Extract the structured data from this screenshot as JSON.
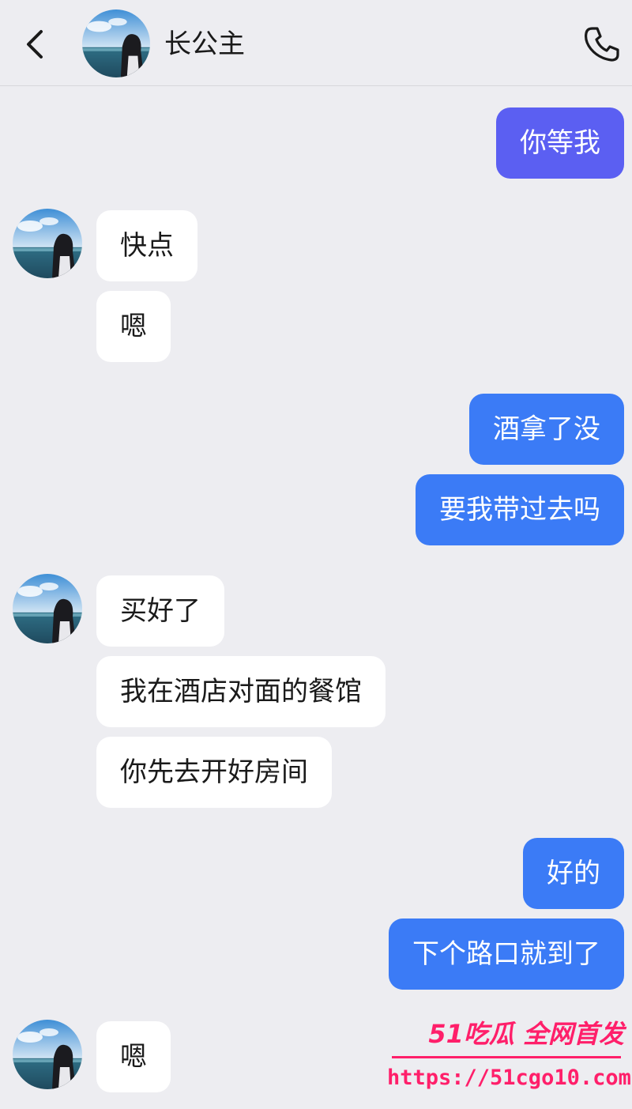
{
  "header": {
    "title": "长公主",
    "back_icon": "chevron-left-icon",
    "call_icon": "phone-icon"
  },
  "messages": [
    {
      "side": "out",
      "text": "你等我",
      "color": "#5b5ff2"
    },
    {
      "side": "in",
      "text": "快点"
    },
    {
      "side": "in",
      "text": "嗯"
    },
    {
      "side": "out",
      "text": "酒拿了没",
      "color": "#3b7bf6"
    },
    {
      "side": "out",
      "text": "要我带过去吗",
      "color": "#3b7bf6"
    },
    {
      "side": "in",
      "text": "买好了"
    },
    {
      "side": "in",
      "text": "我在酒店对面的餐馆"
    },
    {
      "side": "in",
      "text": "你先去开好房间"
    },
    {
      "side": "out",
      "text": "好的",
      "color": "#3b7bf6"
    },
    {
      "side": "out",
      "text": "下个路口就到了",
      "color": "#3b7bf6"
    },
    {
      "side": "in",
      "text": "嗯"
    }
  ],
  "watermark": {
    "line1": "51吃瓜 全网首发",
    "line2": "https://51cgo10.com"
  },
  "colors": {
    "background": "#ededf1",
    "incoming_bubble": "#ffffff",
    "outgoing_purple": "#5b5ff2",
    "outgoing_blue": "#3b7bf6",
    "watermark": "#ff1f6a"
  }
}
